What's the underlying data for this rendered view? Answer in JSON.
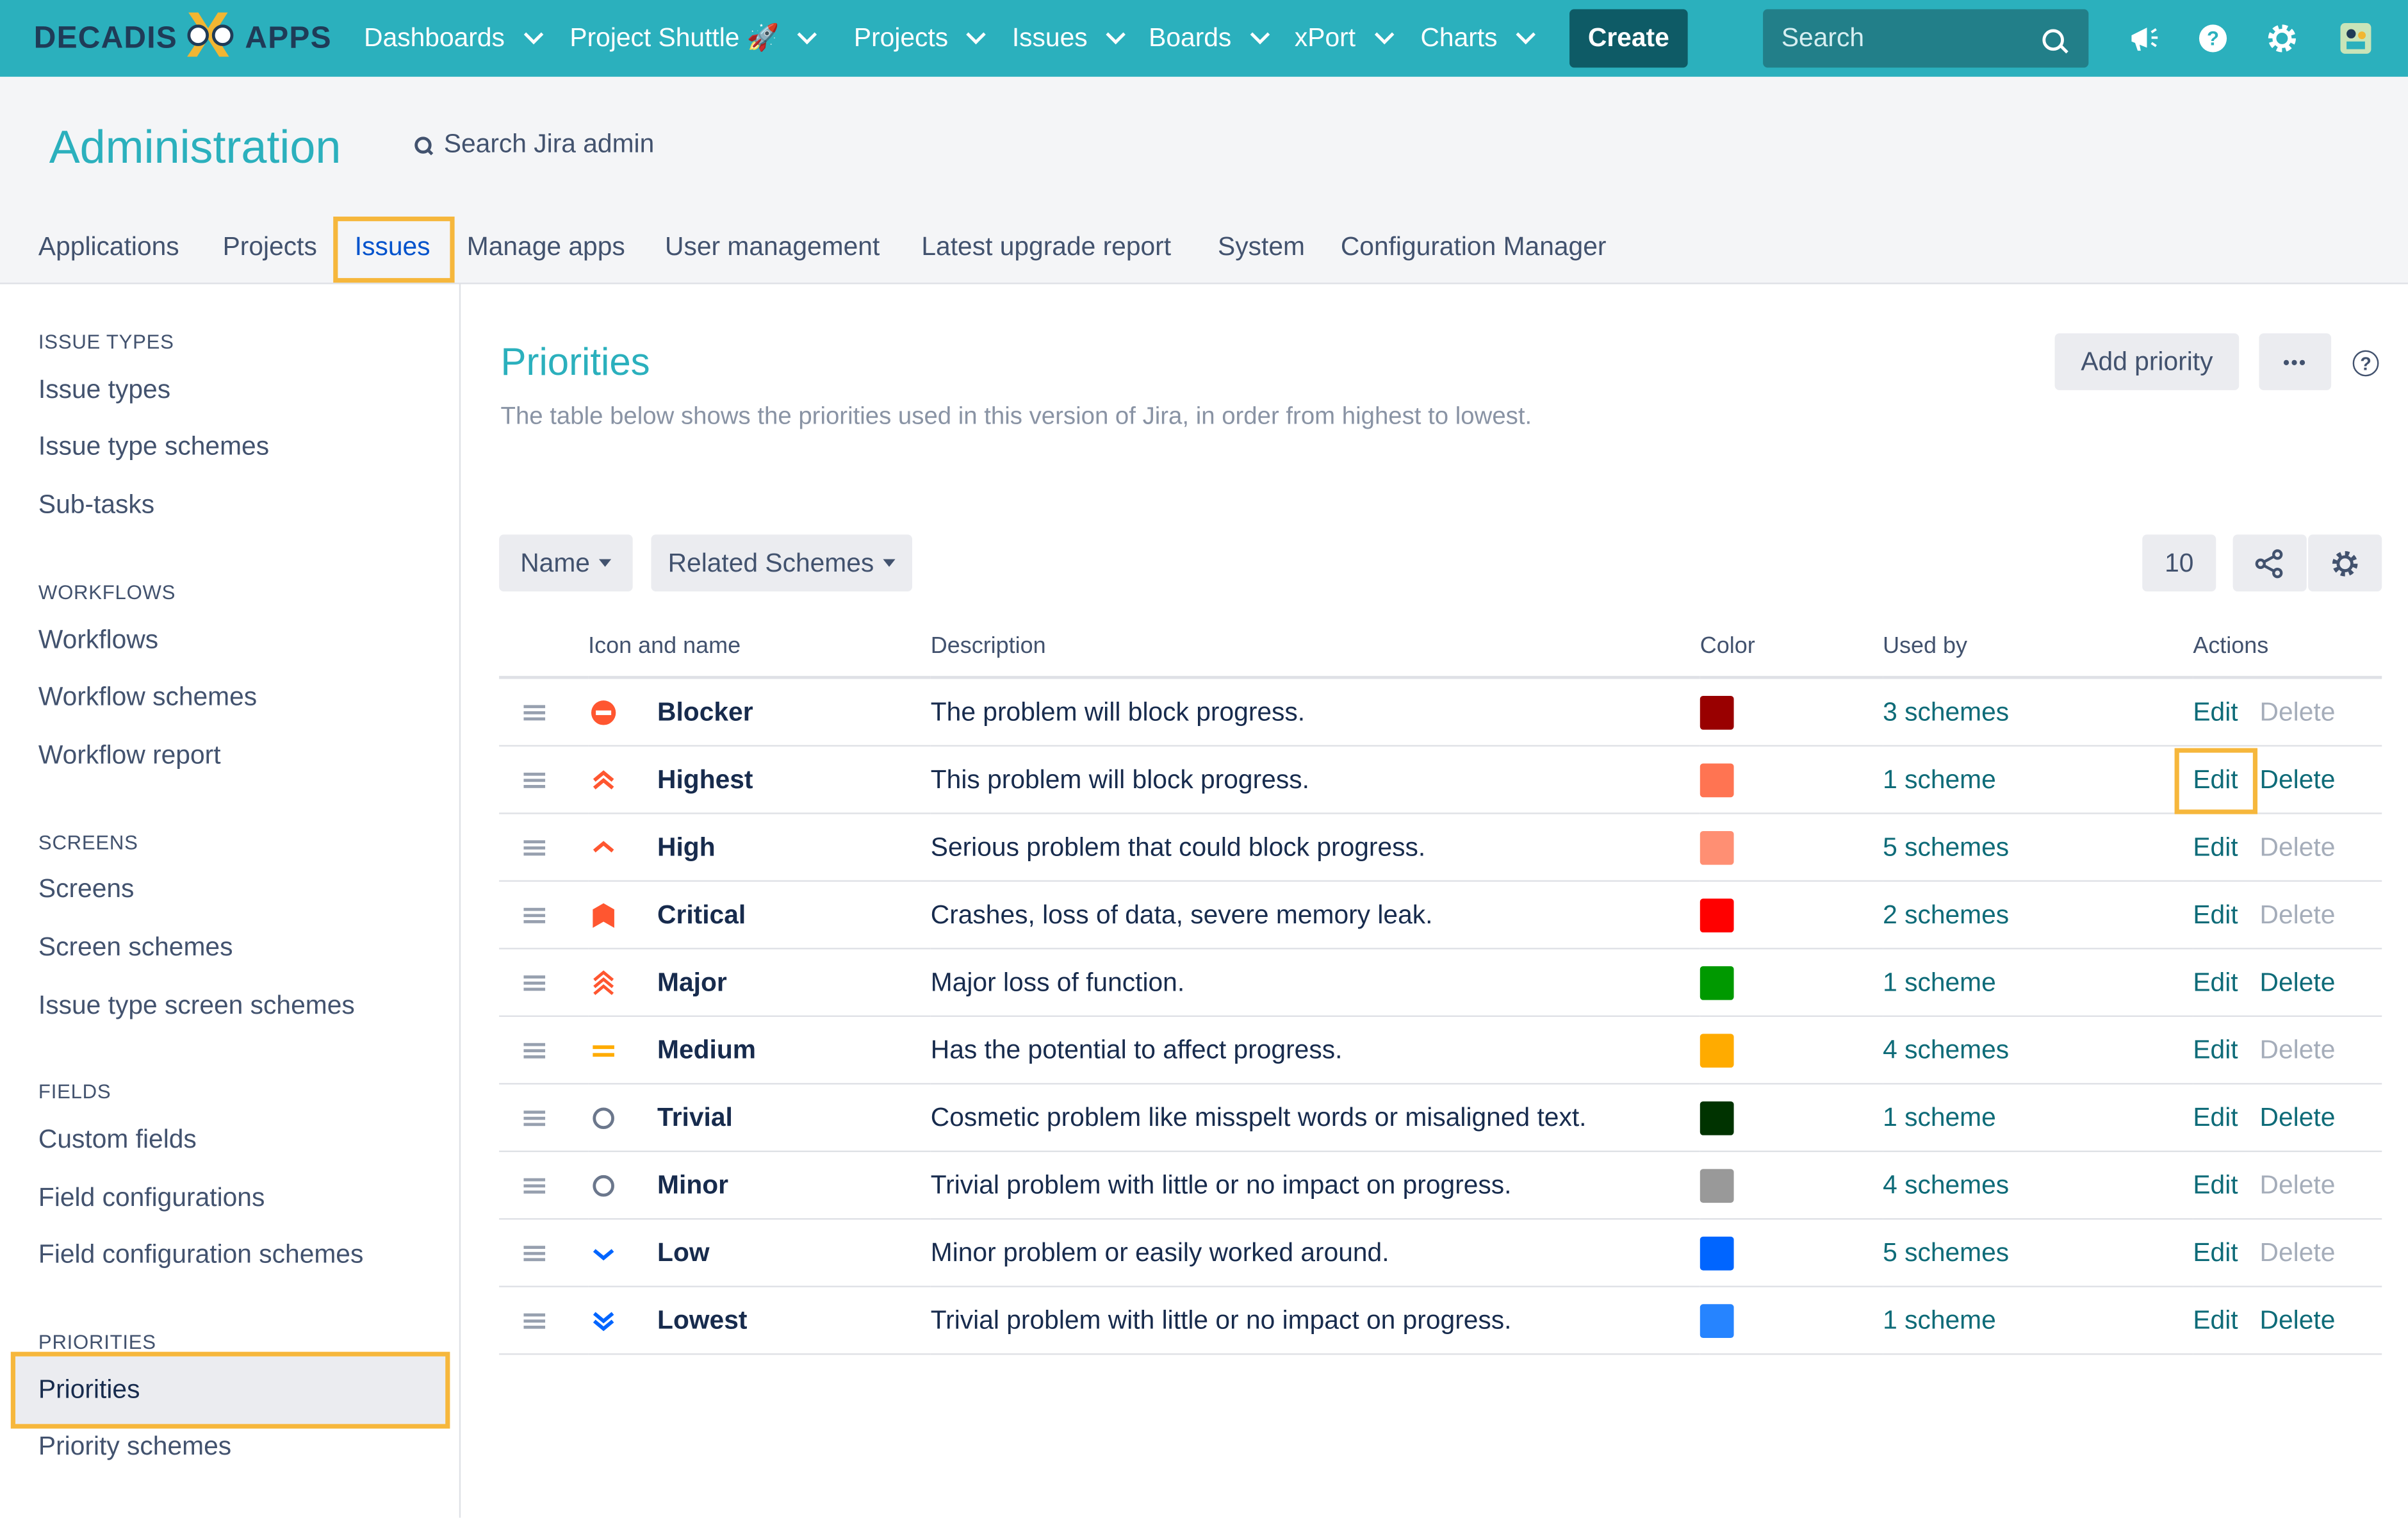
{
  "brand": {
    "left": "DECADIS",
    "right": "APPS"
  },
  "nav": [
    {
      "label": "Dashboards"
    },
    {
      "label": "Project Shuttle 🚀"
    },
    {
      "label": "Projects"
    },
    {
      "label": "Issues"
    },
    {
      "label": "Boards"
    },
    {
      "label": "xPort"
    },
    {
      "label": "Charts"
    }
  ],
  "create_label": "Create",
  "search_placeholder": "Search",
  "topbar_icons": [
    "megaphone-icon",
    "help-icon",
    "settings-icon",
    "avatar"
  ],
  "admin": {
    "title": "Administration",
    "search_label": "Search Jira admin",
    "tabs": [
      "Applications",
      "Projects",
      "Issues",
      "Manage apps",
      "User management",
      "Latest upgrade report",
      "System",
      "Configuration Manager"
    ],
    "active_tab": "Issues"
  },
  "sidebar": {
    "sections": [
      {
        "heading": "ISSUE TYPES",
        "items": [
          "Issue types",
          "Issue type schemes",
          "Sub-tasks"
        ]
      },
      {
        "heading": "WORKFLOWS",
        "items": [
          "Workflows",
          "Workflow schemes",
          "Workflow report"
        ]
      },
      {
        "heading": "SCREENS",
        "items": [
          "Screens",
          "Screen schemes",
          "Issue type screen schemes"
        ]
      },
      {
        "heading": "FIELDS",
        "items": [
          "Custom fields",
          "Field configurations",
          "Field configuration schemes"
        ]
      },
      {
        "heading": "PRIORITIES",
        "items": [
          "Priorities",
          "Priority schemes"
        ]
      }
    ],
    "selected": "Priorities"
  },
  "main": {
    "title": "Priorities",
    "description": "The table below shows the priorities used in this version of Jira, in order from highest to lowest.",
    "add_priority_label": "Add priority",
    "more_label": "•••",
    "help_label": "?",
    "filters": {
      "name_label": "Name",
      "related_label": "Related Schemes"
    },
    "page_size": "10",
    "columns": {
      "icon_name": "Icon and name",
      "description": "Description",
      "color": "Color",
      "used_by": "Used by",
      "actions": "Actions"
    },
    "edit_label": "Edit",
    "delete_label": "Delete"
  },
  "priorities": [
    {
      "name": "Blocker",
      "icon": "blocker-icon",
      "description": "The problem will block progress.",
      "color": "#990000",
      "used_by": "3 schemes",
      "delete_enabled": false
    },
    {
      "name": "Highest",
      "icon": "highest-icon",
      "description": "This problem will block progress.",
      "color": "#ff7452",
      "used_by": "1 scheme",
      "delete_enabled": true
    },
    {
      "name": "High",
      "icon": "high-icon",
      "description": "Serious problem that could block progress.",
      "color": "#ff8f73",
      "used_by": "5 schemes",
      "delete_enabled": false
    },
    {
      "name": "Critical",
      "icon": "critical-icon",
      "description": "Crashes, loss of data, severe memory leak.",
      "color": "#ff0000",
      "used_by": "2 schemes",
      "delete_enabled": false
    },
    {
      "name": "Major",
      "icon": "major-icon",
      "description": "Major loss of function.",
      "color": "#009900",
      "used_by": "1 scheme",
      "delete_enabled": true
    },
    {
      "name": "Medium",
      "icon": "medium-icon",
      "description": "Has the potential to affect progress.",
      "color": "#ffab00",
      "used_by": "4 schemes",
      "delete_enabled": false
    },
    {
      "name": "Trivial",
      "icon": "trivial-icon",
      "description": "Cosmetic problem like misspelt words or misaligned text.",
      "color": "#003300",
      "used_by": "1 scheme",
      "delete_enabled": true
    },
    {
      "name": "Minor",
      "icon": "minor-icon",
      "description": "Trivial problem with little or no impact on progress.",
      "color": "#999999",
      "used_by": "4 schemes",
      "delete_enabled": false
    },
    {
      "name": "Low",
      "icon": "low-icon",
      "description": "Minor problem or easily worked around.",
      "color": "#0065ff",
      "used_by": "5 schemes",
      "delete_enabled": false
    },
    {
      "name": "Lowest",
      "icon": "lowest-icon",
      "description": "Trivial problem with little or no impact on progress.",
      "color": "#2684ff",
      "used_by": "1 scheme",
      "delete_enabled": true
    }
  ],
  "colors": {
    "accent": "#2bb0bd",
    "highlight": "#f6b73c",
    "link": "#0e6b78"
  }
}
